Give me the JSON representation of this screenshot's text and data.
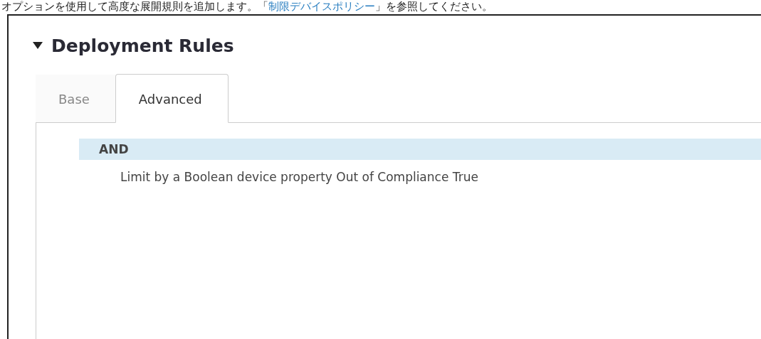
{
  "intro": {
    "text": "オプションを使用して高度な展開規則を追加します。「",
    "link": "制限デバイスポリシー",
    "after": "」を参照してください。"
  },
  "section": {
    "title": "Deployment Rules",
    "expanded": true
  },
  "tabs": [
    {
      "label": "Base",
      "selected": false
    },
    {
      "label": "Advanced",
      "selected": true
    }
  ],
  "rules": [
    {
      "label": "AND",
      "selected": true,
      "children": [
        {
          "label": "Limit by a Boolean device property Out of Compliance True",
          "selected": false
        }
      ]
    }
  ]
}
